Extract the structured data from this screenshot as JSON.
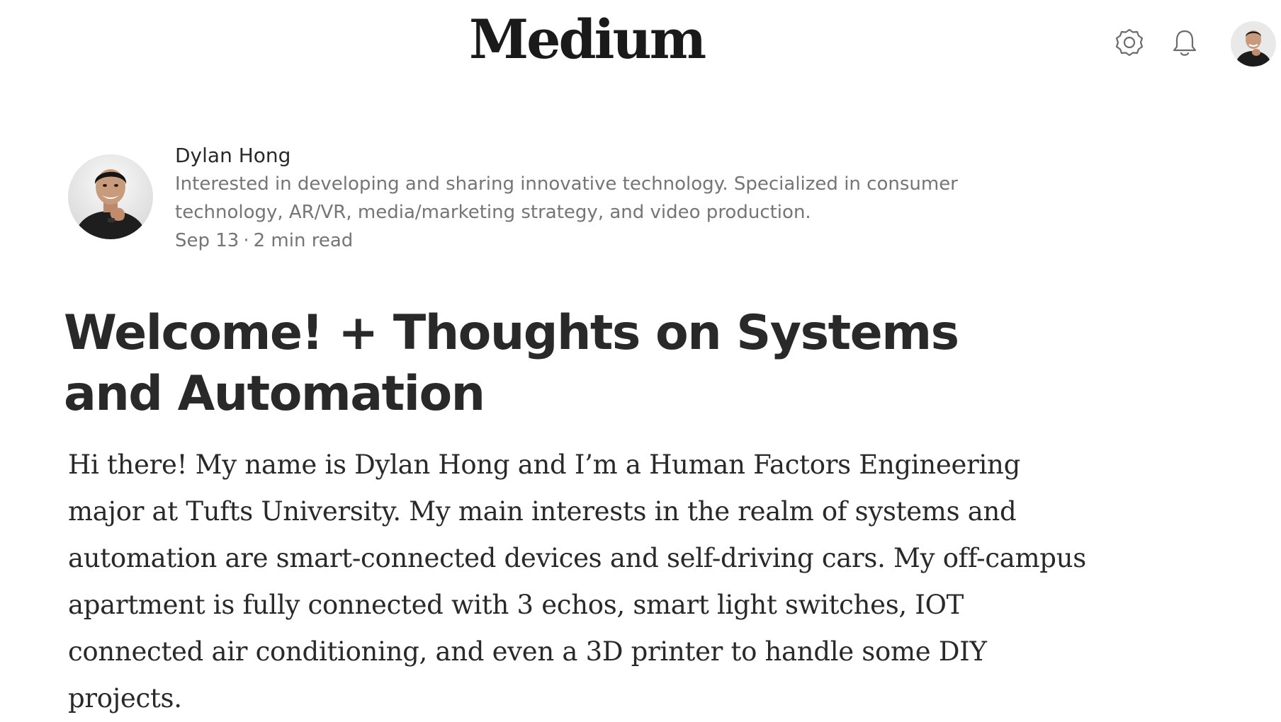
{
  "header": {
    "logo": "Medium",
    "icons": {
      "settings": "gear-icon",
      "notifications": "bell-icon",
      "account": "user-avatar"
    }
  },
  "author": {
    "name": "Dylan Hong",
    "bio": "Interested in developing and sharing innovative technology. Specialized in consumer technology, AR/VR, media/marketing strategy, and video production.",
    "date": "Sep 13",
    "separator": "·",
    "read_time": "2 min read"
  },
  "article": {
    "title": "Welcome! + Thoughts on Systems and Automation",
    "body": "Hi there! My name is Dylan Hong and I’m a Human Factors Engineering major at Tufts University. My main interests in the realm of systems and automation are smart-connected devices and self-driving cars. My off-campus apartment is fully connected with 3 echos, smart light switches, IOT connected air conditioning, and even a 3D printer to handle some DIY projects."
  },
  "colors": {
    "text_primary": "#292929",
    "text_secondary": "#757575",
    "background": "#ffffff"
  }
}
